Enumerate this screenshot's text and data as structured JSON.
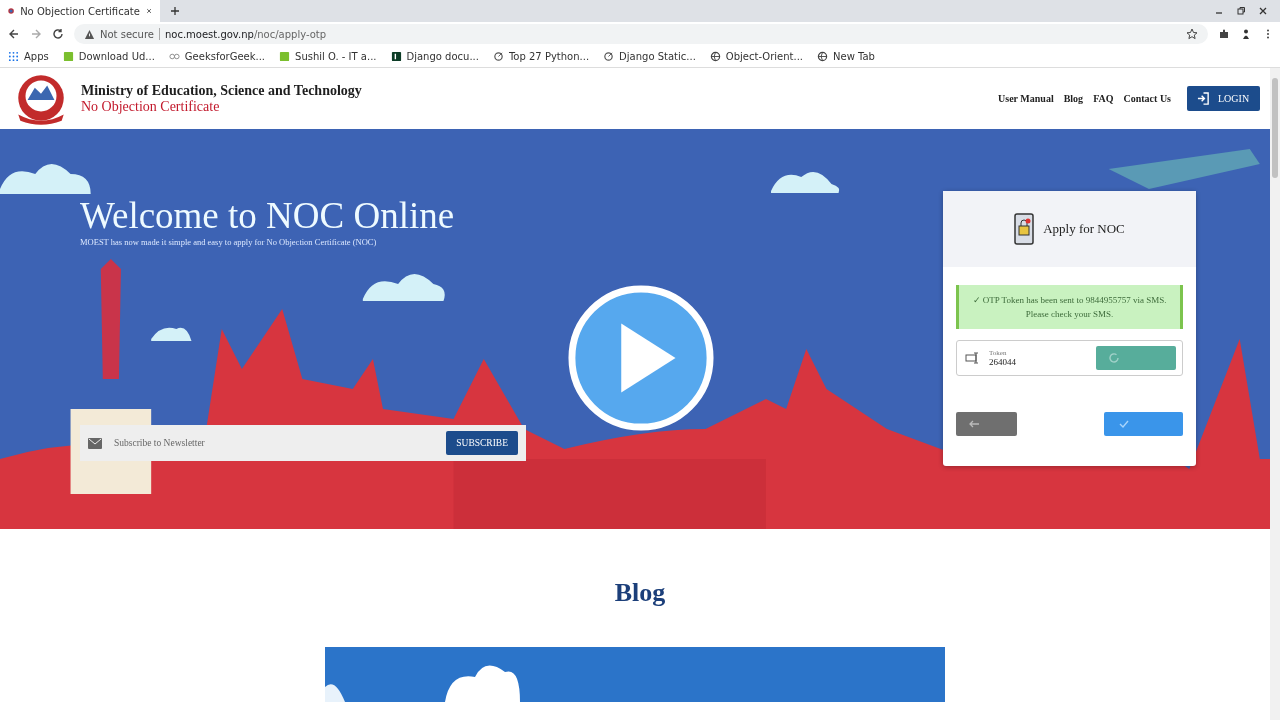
{
  "browser": {
    "tab_title": "No Objection Certificate",
    "security": "Not secure",
    "url_host": "noc.moest.gov.np",
    "url_path": "/noc/apply-otp",
    "bookmarks": [
      {
        "label": "Apps",
        "kind": "apps"
      },
      {
        "label": "Download Ud...",
        "kind": "green"
      },
      {
        "label": "GeeksforGeek...",
        "kind": "gg"
      },
      {
        "label": "Sushil O. - IT a...",
        "kind": "green"
      },
      {
        "label": "Django docu...",
        "kind": "dj"
      },
      {
        "label": "Top 27 Python...",
        "kind": "link"
      },
      {
        "label": "Django Static...",
        "kind": "link"
      },
      {
        "label": "Object-Orient...",
        "kind": "globe"
      },
      {
        "label": "New Tab",
        "kind": "globe"
      }
    ]
  },
  "header": {
    "title": "Ministry of Education, Science and Technology",
    "subtitle": "No Objection Certificate",
    "nav": [
      "User Manual",
      "Blog",
      "FAQ",
      "Contact Us"
    ],
    "login": "LOGIN"
  },
  "hero": {
    "title": "Welcome to NOC Online",
    "subtitle": "MOEST has now made it simple and easy to apply for No Objection Certificate (NOC)",
    "newsletter": {
      "placeholder": "Subscribe to Newsletter",
      "button": "SUBSCRIBE"
    }
  },
  "card": {
    "title": "Apply for NOC",
    "alert": "✓ OTP Token has been sent to 9844955757 via SMS. Please check your SMS.",
    "token_label": "Token",
    "token_value": "264044"
  },
  "blog": {
    "title": "Blog"
  }
}
